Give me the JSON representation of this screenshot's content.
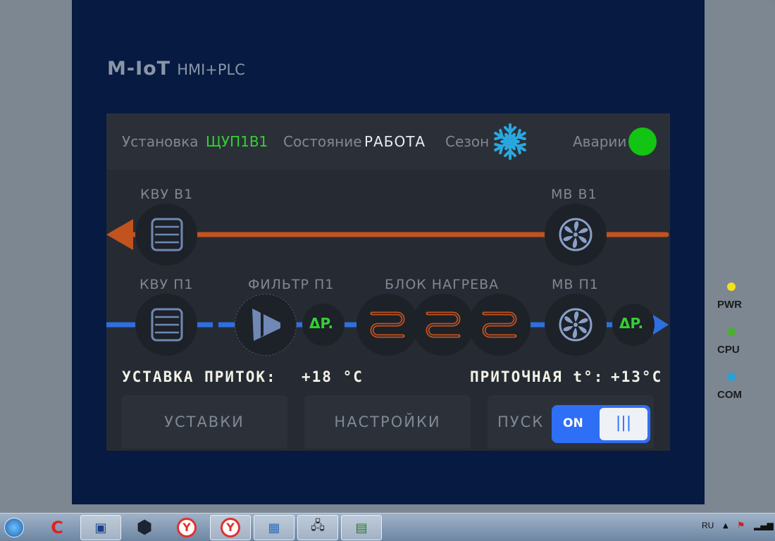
{
  "logo": {
    "brand": "M-IoT",
    "sub": "HMI+PLC"
  },
  "header": {
    "unit_label": "Установка",
    "unit_value": "ЩУП1В1",
    "state_label": "Состояние",
    "state_value": "РАБОТА",
    "season_label": "Сезон",
    "season_icon": "snowflake-icon",
    "alarms_label": "Аварии",
    "alarm_color": "#13c413"
  },
  "labels": {
    "kvu_v1": "КВУ В1",
    "mv_v1": "МВ В1",
    "kvu_p1": "КВУ П1",
    "filter_p1": "ФИЛЬТР П1",
    "heat_block": "БЛОК НАГРЕВА",
    "mv_p1": "МВ П1",
    "dp": "ΔP."
  },
  "readouts": {
    "setpoint_label": "УСТАВКА ПРИТОК:",
    "setpoint_value": "+18 °С",
    "supply_label": "ПРИТОЧНАЯ t°:",
    "supply_value": "+13°С"
  },
  "buttons": {
    "setpoints": "УСТАВКИ",
    "settings": "НАСТРОЙКИ",
    "start": "ПУСК",
    "toggle_on": "ON",
    "toggle_knob": "|||"
  },
  "colors": {
    "exhaust_line": "#c2531f",
    "supply_line": "#2f6fe0",
    "heater": "#c2531f",
    "device_icon": "#6f88b4"
  },
  "leds": [
    {
      "label": "PWR",
      "color": "#f0e020"
    },
    {
      "label": "CPU",
      "color": "#4caf30"
    },
    {
      "label": "COM",
      "color": "#2a9fd8"
    }
  ],
  "taskbar": {
    "lang": "RU"
  }
}
